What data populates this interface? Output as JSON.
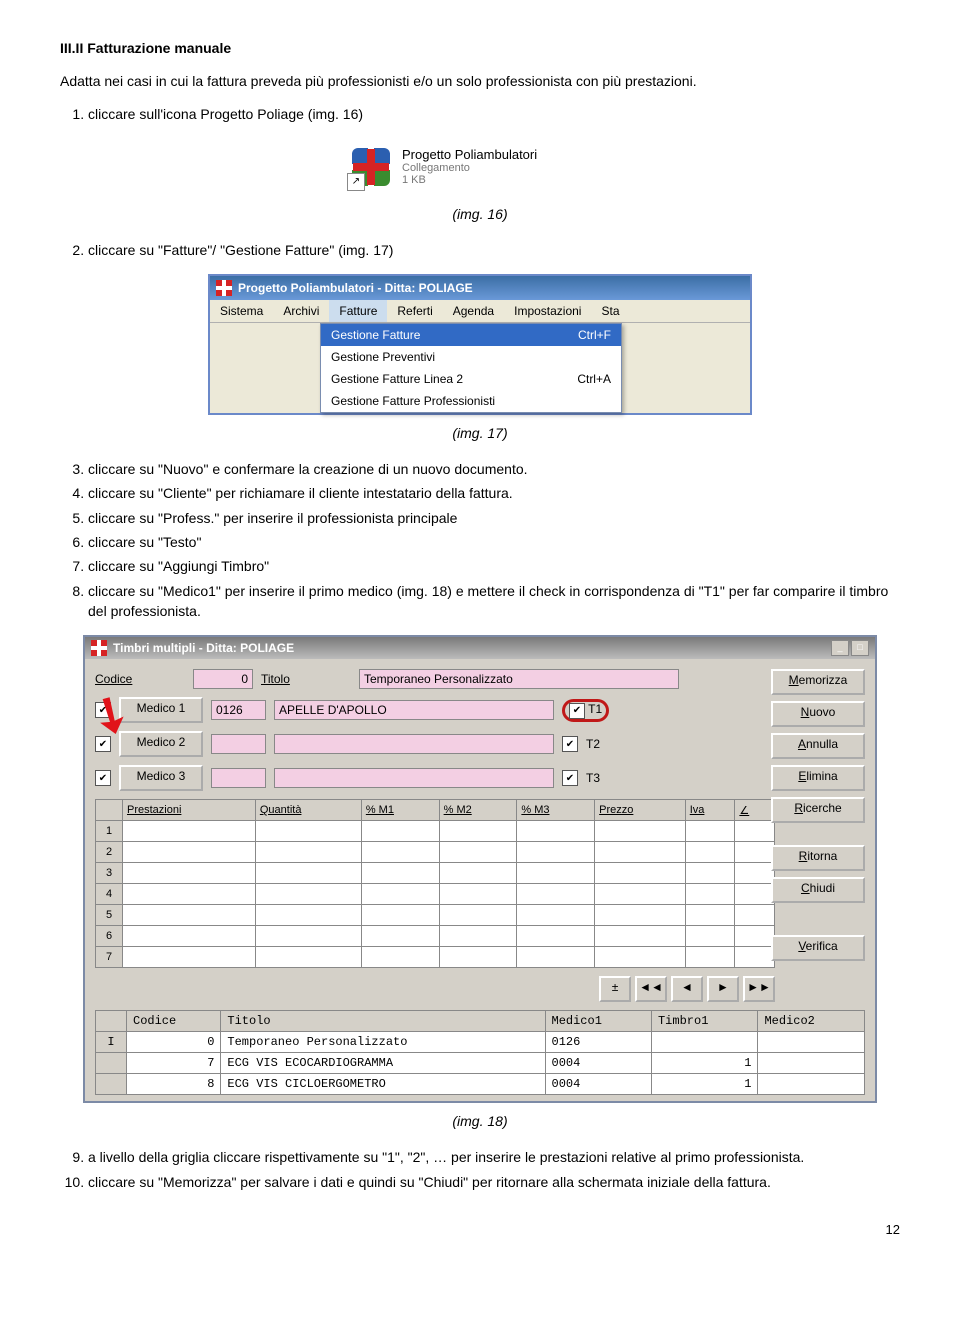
{
  "section_title": "III.II Fatturazione manuale",
  "intro": "Adatta nei casi in cui la fattura preveda più professionisti e/o un solo professionista con più prestazioni.",
  "steps_a": [
    "cliccare sull'icona Progetto Poliage (img. 16)"
  ],
  "shortcut": {
    "name": "Progetto Poliambulatori",
    "sub1": "Collegamento",
    "sub2": "1 KB"
  },
  "caption16": "(img. 16)",
  "steps_b": [
    "cliccare su \"Fatture\"/ \"Gestione Fatture\" (img. 17)"
  ],
  "menubar": {
    "title": "Progetto Poliambulatori - Ditta: POLIAGE",
    "items": [
      "Sistema",
      "Archivi",
      "Fatture",
      "Referti",
      "Agenda",
      "Impostazioni",
      "Sta"
    ],
    "dropdown": [
      {
        "label": "Gestione Fatture",
        "accel": "Ctrl+F",
        "sel": true
      },
      {
        "label": "Gestione Preventivi",
        "accel": "",
        "sel": false
      },
      {
        "label": "Gestione Fatture Linea 2",
        "accel": "Ctrl+A",
        "sel": false
      },
      {
        "label": "Gestione Fatture Professionisti",
        "accel": "",
        "sel": false
      }
    ]
  },
  "caption17": "(img. 17)",
  "steps_c": [
    "cliccare su \"Nuovo\" e confermare la creazione di un nuovo documento.",
    "cliccare su \"Cliente\" per richiamare il cliente intestatario della fattura.",
    "cliccare su \"Profess.\" per inserire il professionista principale",
    "cliccare su \"Testo\"",
    "cliccare su \"Aggiungi Timbro\"",
    "cliccare su \"Medico1\" per inserire il primo medico (img. 18) e mettere il check in corrispondenza di \"T1\" per far comparire il timbro del professionista."
  ],
  "tm": {
    "title": "Timbri multipli - Ditta: POLIAGE",
    "labels": {
      "codice": "Codice",
      "titolo": "Titolo",
      "medico1": "Medico 1",
      "medico2": "Medico 2",
      "medico3": "Medico 3",
      "t1": "T1",
      "t2": "T2",
      "t3": "T3",
      "prest": "Prestazioni",
      "qta": "Quantità",
      "m1": "% M1",
      "m2": "% M2",
      "m3": "% M3",
      "prezzo": "Prezzo",
      "iva": "Iva",
      "ang": "∠"
    },
    "values": {
      "codice": "0",
      "titolo": "Temporaneo Personalizzato",
      "m1_code": "0126",
      "m1_name": "APELLE D'APOLLO"
    },
    "buttons": [
      "Memorizza",
      "Nuovo",
      "Annulla",
      "Elimina",
      "Ricerche",
      "",
      "Ritorna",
      "Chiudi",
      "",
      "Verifica"
    ],
    "nav": [
      "±",
      "◄◄",
      "◄",
      "►",
      "►►"
    ],
    "bottom_headers": [
      "Codice",
      "Titolo",
      "Medico1",
      "Timbro1",
      "Medico2"
    ],
    "bottom_rows": [
      {
        "mark": "I",
        "codice": "0",
        "titolo": "Temporaneo Personalizzato",
        "m1": "0126",
        "t1": "",
        "m2": ""
      },
      {
        "mark": "",
        "codice": "7",
        "titolo": "ECG VIS ECOCARDIOGRAMMA",
        "m1": "0004",
        "t1": "1",
        "m2": ""
      },
      {
        "mark": "",
        "codice": "8",
        "titolo": "ECG VIS CICLOERGOMETRO",
        "m1": "0004",
        "t1": "1",
        "m2": ""
      }
    ]
  },
  "caption18": "(img. 18)",
  "steps_d": [
    "a livello della griglia cliccare rispettivamente su \"1\", \"2\", … per inserire le prestazioni relative al primo professionista.",
    "cliccare su \"Memorizza\" per salvare i dati e quindi su \"Chiudi\" per ritornare alla schermata iniziale della fattura."
  ],
  "page_num": "12"
}
